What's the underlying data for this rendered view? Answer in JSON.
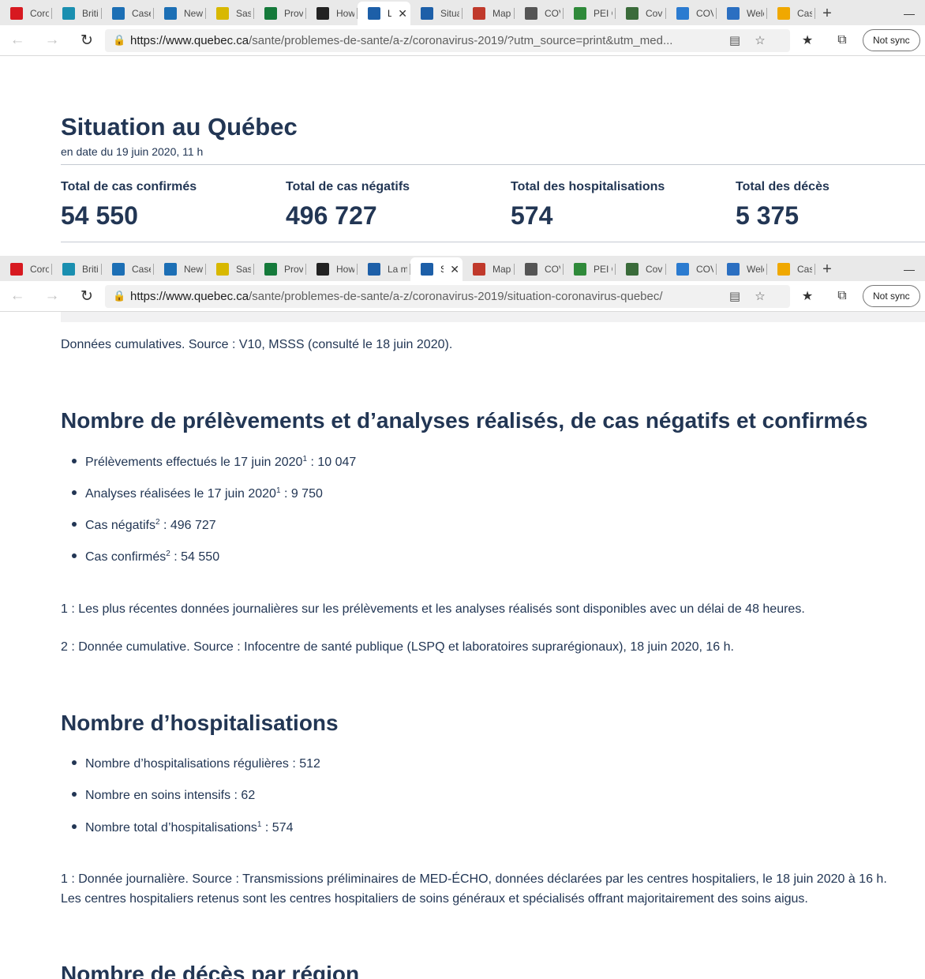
{
  "browser_top": {
    "tabs": [
      {
        "title": "Coror",
        "icon": "maple-leaf-icon",
        "color": "#d71920"
      },
      {
        "title": "Britisl",
        "icon": "bc-shield-icon",
        "color": "#1a8fb0"
      },
      {
        "title": "Cases",
        "icon": "mountain-icon",
        "color": "#1c6fb5"
      },
      {
        "title": "News",
        "icon": "mountain-icon",
        "color": "#1c6fb5"
      },
      {
        "title": "Saska",
        "icon": "wheat-icon",
        "color": "#d8b800"
      },
      {
        "title": "Provi",
        "icon": "bison-icon",
        "color": "#157a3b"
      },
      {
        "title": "How",
        "icon": "shield-icon",
        "color": "#222222"
      },
      {
        "title": "L",
        "icon": "fleur-de-lis-icon",
        "color": "#1d5fa8"
      },
      {
        "title": "Situat",
        "icon": "fleur-de-lis-icon",
        "color": "#1d5fa8"
      },
      {
        "title": "Maps",
        "icon": "map-pen-icon",
        "color": "#c0392b"
      },
      {
        "title": "COVII",
        "icon": "ship-icon",
        "color": "#555555"
      },
      {
        "title": "PEI Cl",
        "icon": "tree-icon",
        "color": "#2f8a3a"
      },
      {
        "title": "Covid",
        "icon": "globe-icon",
        "color": "#3a6b3a"
      },
      {
        "title": "COVII",
        "icon": "globe-blue-icon",
        "color": "#2b7bd0"
      },
      {
        "title": "Welcc",
        "icon": "arch-icon",
        "color": "#2b6fc1"
      },
      {
        "title": "Case",
        "icon": "sun-icon",
        "color": "#f0a800"
      }
    ],
    "active_index": 7,
    "url_host": "https://www.quebec.ca",
    "url_path": "/sante/problemes-de-sante/a-z/coronavirus-2019/?utm_source=print&utm_med...",
    "sync_label": "Not sync"
  },
  "browser_bottom": {
    "tabs": [
      {
        "title": "Coror",
        "icon": "maple-leaf-icon",
        "color": "#d71920"
      },
      {
        "title": "Britisl",
        "icon": "bc-shield-icon",
        "color": "#1a8fb0"
      },
      {
        "title": "Cases",
        "icon": "mountain-icon",
        "color": "#1c6fb5"
      },
      {
        "title": "News",
        "icon": "mountain-icon",
        "color": "#1c6fb5"
      },
      {
        "title": "Saska",
        "icon": "wheat-icon",
        "color": "#d8b800"
      },
      {
        "title": "Provi",
        "icon": "bison-icon",
        "color": "#157a3b"
      },
      {
        "title": "How",
        "icon": "shield-icon",
        "color": "#222222"
      },
      {
        "title": "La ma",
        "icon": "fleur-de-lis-icon",
        "color": "#1d5fa8"
      },
      {
        "title": "S",
        "icon": "fleur-de-lis-icon",
        "color": "#1d5fa8"
      },
      {
        "title": "Maps",
        "icon": "map-pen-icon",
        "color": "#c0392b"
      },
      {
        "title": "COVII",
        "icon": "ship-icon",
        "color": "#555555"
      },
      {
        "title": "PEI Cl",
        "icon": "tree-icon",
        "color": "#2f8a3a"
      },
      {
        "title": "Covid",
        "icon": "globe-icon",
        "color": "#3a6b3a"
      },
      {
        "title": "COVII",
        "icon": "globe-blue-icon",
        "color": "#2b7bd0"
      },
      {
        "title": "Welcc",
        "icon": "arch-icon",
        "color": "#2b6fc1"
      },
      {
        "title": "Case",
        "icon": "sun-icon",
        "color": "#f0a800"
      }
    ],
    "active_index": 8,
    "url_host": "https://www.quebec.ca",
    "url_path": "/sante/problemes-de-sante/a-z/coronavirus-2019/situation-coronavirus-quebec/",
    "sync_label": "Not sync"
  },
  "summary": {
    "title": "Situation au Québec",
    "date": "en date du 19 juin 2020, 11 h",
    "stats": [
      {
        "label": "Total de cas confirmés",
        "value": "54 550"
      },
      {
        "label": "Total de cas négatifs",
        "value": "496 727"
      },
      {
        "label": "Total des hospitalisations",
        "value": "574"
      },
      {
        "label": "Total des décès",
        "value": "5 375"
      }
    ]
  },
  "content": {
    "source_note": "Données cumulatives. Source : V10, MSSS (consulté le 18 juin 2020).",
    "tests_heading": "Nombre de prélèvements et d’analyses réalisés, de cas négatifs et confirmés",
    "tests_items": [
      {
        "label": "Prélèvements effectués le 17 juin 2020",
        "sup": "1",
        "value": " : 10 047"
      },
      {
        "label": "Analyses réalisées le 17 juin 2020",
        "sup": "1",
        "value": " : 9 750"
      },
      {
        "label": "Cas négatifs",
        "sup": "2",
        "value": " : 496 727"
      },
      {
        "label": "Cas confirmés",
        "sup": "2",
        "value": " : 54 550"
      }
    ],
    "tests_note1": "1 : Les plus récentes données journalières sur les prélèvements et les analyses réalisés sont disponibles avec un délai de 48 heures.",
    "tests_note2": "2 : Donnée cumulative. Source : Infocentre de santé publique (LSPQ et laboratoires suprarégionaux), 18 juin 2020, 16 h.",
    "hosp_heading": "Nombre d’hospitalisations",
    "hosp_items": [
      {
        "label": "Nombre d’hospitalisations régulières : 512",
        "sup": "",
        "value": ""
      },
      {
        "label": "Nombre en soins intensifs : 62",
        "sup": "",
        "value": ""
      },
      {
        "label": "Nombre total d’hospitalisations",
        "sup": "1",
        "value": " : 574"
      }
    ],
    "hosp_note_line1": "1 : Donnée journalière. Source : Transmissions préliminaires de MED-ÉCHO, données déclarées par les centres hospitaliers, le 18 juin 2020 à 16 h.",
    "hosp_note_line2": "Les centres hospitaliers retenus sont les centres hospitaliers de soins généraux et spécialisés offrant majoritairement des soins aigus.",
    "deaths_heading": "Nombre de décès par région"
  }
}
